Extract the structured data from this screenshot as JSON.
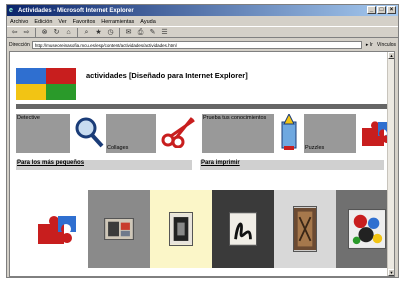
{
  "window": {
    "title": "Actividades - Microsoft Internet Explorer",
    "controls": [
      "_",
      "□",
      "×"
    ]
  },
  "menu": [
    "Archivo",
    "Edición",
    "Ver",
    "Favoritos",
    "Herramientas",
    "Ayuda"
  ],
  "address": {
    "label": "Dirección",
    "url": "http://museoreinasofia.mcu.es/esp/content/actividades/actividades.html",
    "go_label": "Ir",
    "links_label": "Vínculos"
  },
  "page": {
    "title": "actividades [Diseñado para Internet Explorer]",
    "tiles": {
      "detective": "Detective",
      "collages": "Collages",
      "quiz": "Prueba tus conocimientos",
      "puzzles": "Puzzles"
    },
    "links": {
      "small": "Para los más pequeños",
      "print": "Para imprimir"
    }
  },
  "colors": {
    "logo_blue": "#2f6fd0",
    "logo_red": "#c81e1e",
    "logo_yellow": "#f2c414",
    "logo_green": "#2a9a2a",
    "tile_gray": "#999999",
    "rule_gray": "#666666"
  },
  "icons": {
    "magnifier": "magnifier-icon",
    "scissors": "scissors-icon",
    "pencil": "pencil-icon",
    "puzzle": "puzzle-icon"
  }
}
